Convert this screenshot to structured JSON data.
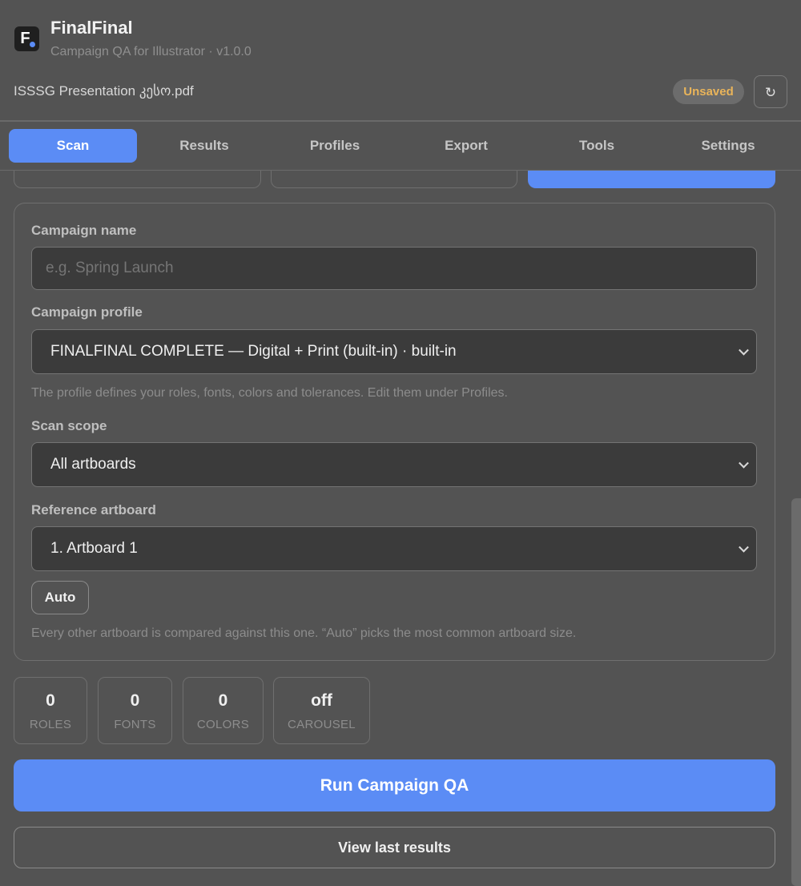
{
  "header": {
    "logo_letter": "F",
    "app_title": "FinalFinal",
    "app_subtitle": "Campaign QA for Illustrator · v1.0.0",
    "document_name": "ISSSG Presentation კესო.pdf",
    "status_badge": "Unsaved",
    "refresh_glyph": "↻"
  },
  "tabs": [
    {
      "label": "Scan",
      "active": true
    },
    {
      "label": "Results",
      "active": false
    },
    {
      "label": "Profiles",
      "active": false
    },
    {
      "label": "Export",
      "active": false
    },
    {
      "label": "Tools",
      "active": false
    },
    {
      "label": "Settings",
      "active": false
    }
  ],
  "form": {
    "campaign_name": {
      "label": "Campaign name",
      "value": "",
      "placeholder": "e.g. Spring Launch"
    },
    "campaign_profile": {
      "label": "Campaign profile",
      "selected": "FINALFINAL COMPLETE — Digital + Print (built-in) · built-in",
      "help": "The profile defines your roles, fonts, colors and tolerances. Edit them under Profiles."
    },
    "scan_scope": {
      "label": "Scan scope",
      "selected": "All artboards"
    },
    "reference_artboard": {
      "label": "Reference artboard",
      "selected": "1. Artboard 1",
      "auto_label": "Auto",
      "help": "Every other artboard is compared against this one. “Auto” picks the most common artboard size."
    }
  },
  "stats": [
    {
      "value": "0",
      "label": "ROLES"
    },
    {
      "value": "0",
      "label": "FONTS"
    },
    {
      "value": "0",
      "label": "COLORS"
    },
    {
      "value": "off",
      "label": "CAROUSEL"
    }
  ],
  "actions": {
    "run_label": "Run Campaign QA",
    "view_label": "View last results"
  },
  "colors": {
    "accent": "#5b8cf5",
    "background": "#535353",
    "field_bg": "#3b3b3b",
    "badge_text": "#e9b45a"
  },
  "icons": {
    "refresh": "refresh-icon",
    "dropdown": "chevron-down-icon"
  }
}
